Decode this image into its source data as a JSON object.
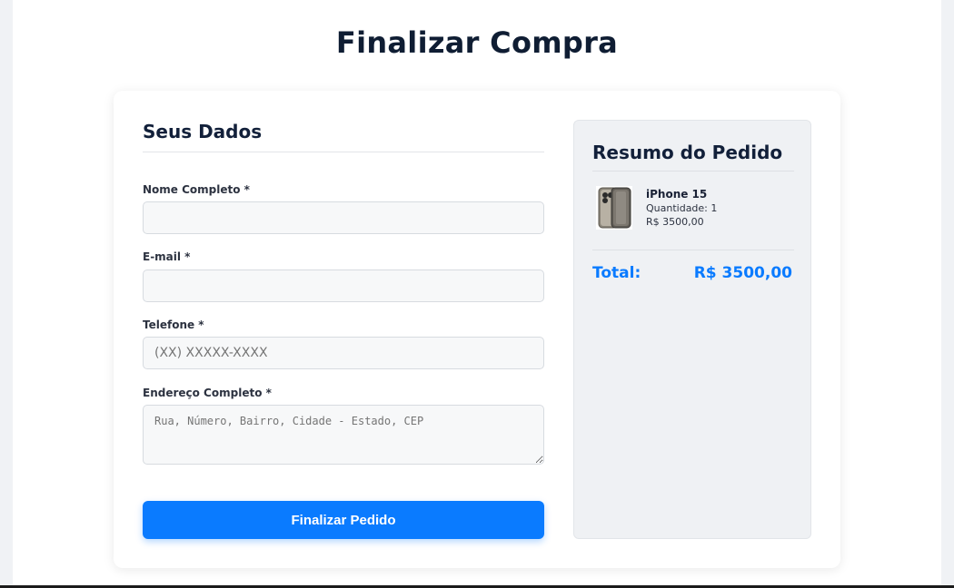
{
  "page": {
    "title": "Finalizar Compra"
  },
  "form": {
    "section_title": "Seus Dados",
    "fields": [
      {
        "label": "Nome Completo *",
        "value": "",
        "placeholder": ""
      },
      {
        "label": "E-mail *",
        "value": "",
        "placeholder": ""
      },
      {
        "label": "Telefone *",
        "value": "",
        "placeholder": "(XX) XXXXX-XXXX"
      },
      {
        "label": "Endereço Completo *",
        "value": "",
        "placeholder": "Rua, Número, Bairro, Cidade - Estado, CEP"
      }
    ],
    "submit_label": "Finalizar Pedido"
  },
  "summary": {
    "title": "Resumo do Pedido",
    "items": [
      {
        "name": "iPhone 15",
        "quantity": "Quantidade: 1",
        "price": "R$ 3500,00",
        "image_icon": "iphone-product-image"
      }
    ],
    "total_label": "Total:",
    "total_value": "R$ 3500,00"
  },
  "colors": {
    "accent": "#0a7bff",
    "page_background": "#f0f2f5",
    "card_background": "#ffffff",
    "summary_background": "#eff1f4",
    "heading_text": "#0f1d33"
  }
}
